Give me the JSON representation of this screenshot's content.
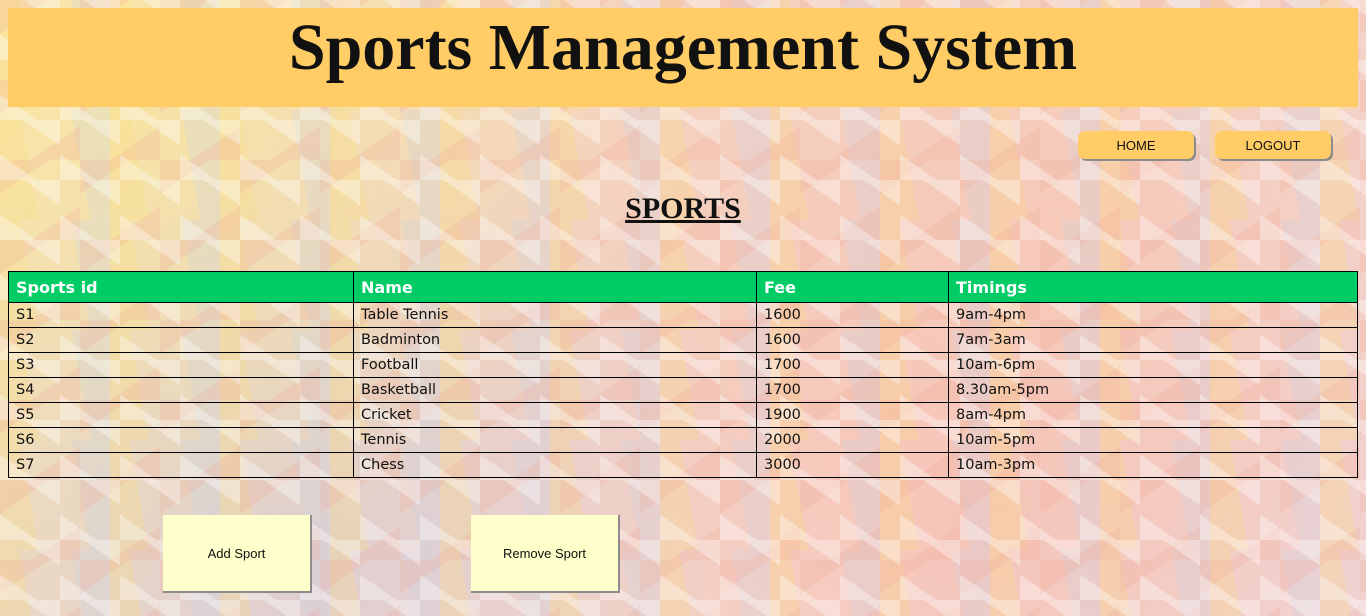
{
  "header": {
    "title": "Sports Management System"
  },
  "nav": {
    "home_label": "HOME",
    "logout_label": "LOGOUT"
  },
  "section": {
    "title": "SPORTS"
  },
  "table": {
    "columns": [
      "Sports id",
      "Name",
      "Fee",
      "Timings"
    ],
    "rows": [
      [
        "S1",
        "Table Tennis",
        "1600",
        "9am-4pm"
      ],
      [
        "S2",
        "Badminton",
        "1600",
        "7am-3am"
      ],
      [
        "S3",
        "Football",
        "1700",
        "10am-6pm"
      ],
      [
        "S4",
        "Basketball",
        "1700",
        "8.30am-5pm"
      ],
      [
        "S5",
        "Cricket",
        "1900",
        "8am-4pm"
      ],
      [
        "S6",
        "Tennis",
        "2000",
        "10am-5pm"
      ],
      [
        "S7",
        "Chess",
        "3000",
        "10am-3pm"
      ]
    ]
  },
  "actions": {
    "add_label": "Add Sport",
    "remove_label": "Remove Sport"
  },
  "colors": {
    "banner": "#ffcc66",
    "table_header": "#00cc66",
    "action_button": "#ffffcc"
  }
}
